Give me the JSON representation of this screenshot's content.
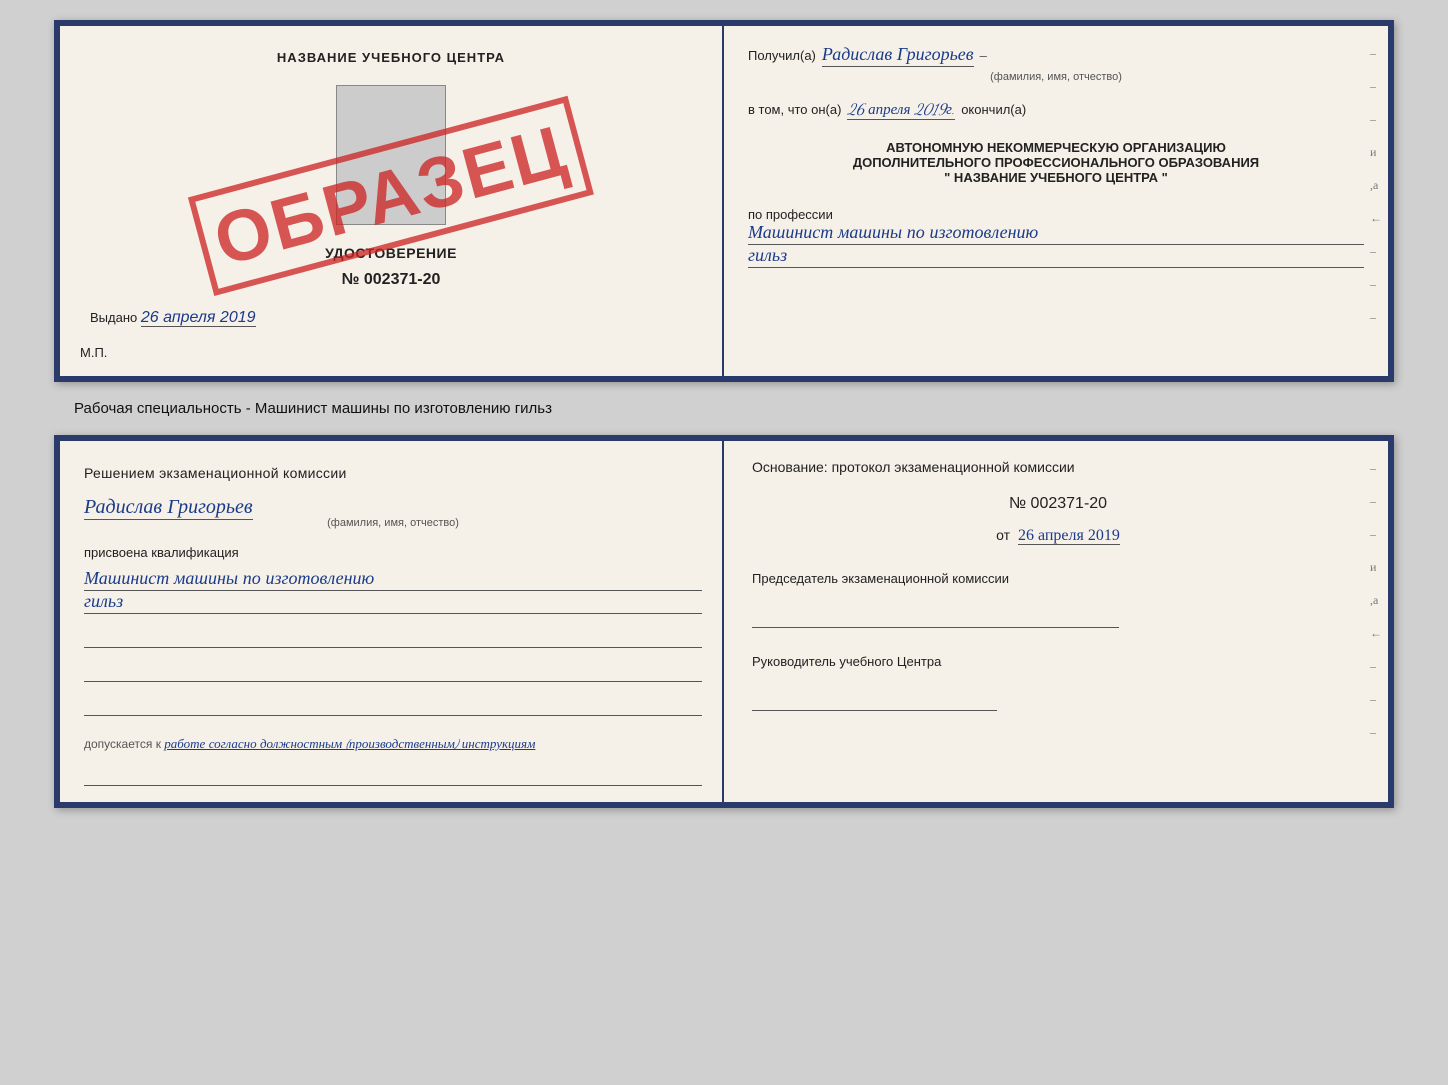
{
  "top_doc": {
    "left": {
      "center_heading": "НАЗВАНИЕ УЧЕБНОГО ЦЕНТРА",
      "stamp_text": "ОБРАЗЕЦ",
      "cert_title": "УДОСТОВЕРЕНИЕ",
      "cert_number": "№ 002371-20",
      "issued_label": "Выдано",
      "issued_date": "26 апреля 2019",
      "mp_label": "М.П."
    },
    "right": {
      "received_label": "Получил(а)",
      "name": "Радислав Григорьев",
      "name_sub": "(фамилия, имя, отчество)",
      "in_that_label": "в том, что он(а)",
      "completed_date": "26 апреля 2019г.",
      "completed_label": "окончил(а)",
      "org_line1": "АВТОНОМНУЮ НЕКОММЕРЧЕСКУЮ ОРГАНИЗАЦИЮ",
      "org_line2": "ДОПОЛНИТЕЛЬНОГО ПРОФЕССИОНАЛЬНОГО ОБРАЗОВАНИЯ",
      "org_quote": "\" НАЗВАНИЕ УЧЕБНОГО ЦЕНТРА \"",
      "profession_label": "по профессии",
      "profession_line1": "Машинист машины по изготовлению",
      "profession_line2": "гильз"
    }
  },
  "subtitle": "Рабочая специальность - Машинист машины по изготовлению гильз",
  "bottom_doc": {
    "left": {
      "decision_text": "Решением  экзаменационной  комиссии",
      "name": "Радислав Григорьев",
      "name_sub": "(фамилия, имя, отчество)",
      "assigned_label": "присвоена квалификация",
      "profession_line1": "Машинист машины по изготовлению",
      "profession_line2": "гильз",
      "allowed_prefix": "допускается к",
      "allowed_text": "работе согласно должностным (производственным) инструкциям"
    },
    "right": {
      "basis_label": "Основание: протокол экзаменационной  комиссии",
      "protocol_number": "№  002371-20",
      "protocol_date_prefix": "от",
      "protocol_date": "26 апреля 2019",
      "commission_chair_label": "Председатель экзаменационной комиссии",
      "center_head_label": "Руководитель учебного Центра"
    }
  }
}
